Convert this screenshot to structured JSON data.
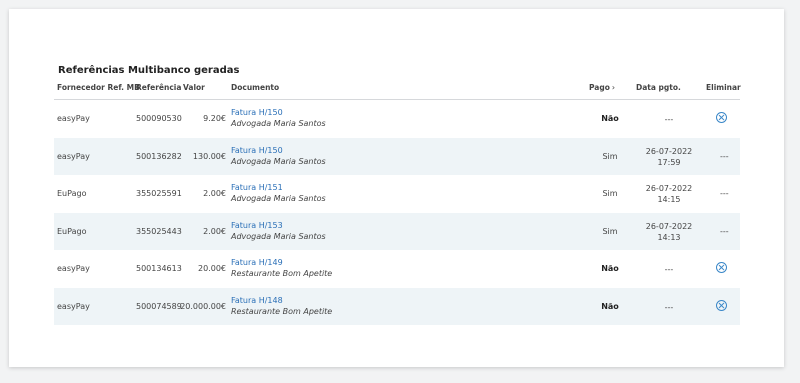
{
  "title": "Referências Multibanco geradas",
  "columns": {
    "provider": "Fornecedor Ref. MB",
    "reference": "Referência",
    "value": "Valor",
    "document": "Documento",
    "paid": "Pago",
    "paid_chevron": "›",
    "payment_date": "Data pgto.",
    "delete": "Eliminar"
  },
  "rows": [
    {
      "provider": "easyPay",
      "reference": "500090530",
      "value": "9.20€",
      "doc": "Fatura H/150",
      "client": "Advogada Maria Santos",
      "paid": "Não",
      "date": "---",
      "time": "",
      "deletable": true
    },
    {
      "provider": "easyPay",
      "reference": "500136282",
      "value": "130.00€",
      "doc": "Fatura H/150",
      "client": "Advogada Maria Santos",
      "paid": "Sim",
      "date": "26-07-2022",
      "time": "17:59",
      "deletable": false,
      "delete_text": "---"
    },
    {
      "provider": "EuPago",
      "reference": "355025591",
      "value": "2.00€",
      "doc": "Fatura H/151",
      "client": "Advogada Maria Santos",
      "paid": "Sim",
      "date": "26-07-2022",
      "time": "14:15",
      "deletable": false,
      "delete_text": "---"
    },
    {
      "provider": "EuPago",
      "reference": "355025443",
      "value": "2.00€",
      "doc": "Fatura H/153",
      "client": "Advogada Maria Santos",
      "paid": "Sim",
      "date": "26-07-2022",
      "time": "14:13",
      "deletable": false,
      "delete_text": "---"
    },
    {
      "provider": "easyPay",
      "reference": "500134613",
      "value": "20.00€",
      "doc": "Fatura H/149",
      "client": "Restaurante Bom Apetite",
      "paid": "Não",
      "date": "---",
      "time": "",
      "deletable": true
    },
    {
      "provider": "easyPay",
      "reference": "500074589",
      "value": "20.000.00€",
      "doc": "Fatura H/148",
      "client": "Restaurante Bom Apetite",
      "paid": "Não",
      "date": "---",
      "time": "",
      "deletable": true
    }
  ],
  "colors": {
    "link": "#2a6fb7",
    "alt_row": "#eef4f7",
    "icon": "#3a87c8"
  }
}
